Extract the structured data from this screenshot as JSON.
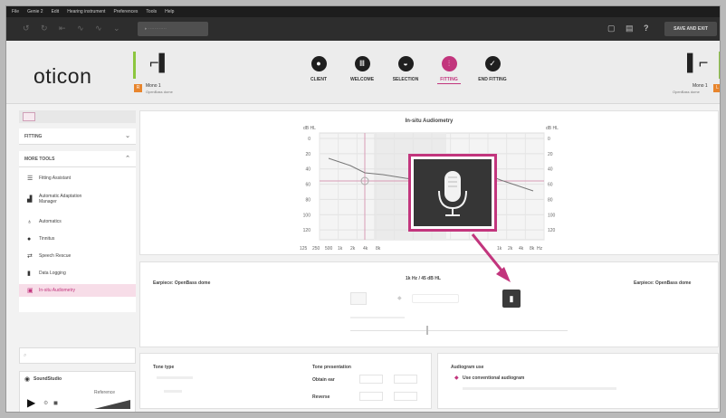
{
  "menubar": [
    "File",
    "Genie 2",
    "Edit",
    "Hearing instrument",
    "Preferences",
    "Tools",
    "Help"
  ],
  "toolbar": {
    "save_exit": "SAVE AND EXIT",
    "help_label": "?"
  },
  "header": {
    "logo": "oticon",
    "left_device": {
      "name": "Mono 1",
      "sub": "OpenBass dome",
      "badge": "R"
    },
    "right_device": {
      "name": "Mono 1",
      "sub": "OpenBass dome",
      "badge": "L"
    },
    "nav": [
      {
        "label": "CLIENT",
        "icon": "person-icon"
      },
      {
        "label": "WELCOME",
        "icon": "welcome-icon"
      },
      {
        "label": "SELECTION",
        "icon": "selection-icon"
      },
      {
        "label": "FITTING",
        "icon": "fitting-icon",
        "active": true
      },
      {
        "label": "END FITTING",
        "icon": "check-icon"
      }
    ]
  },
  "sidebar": {
    "fitting_header": "FITTING",
    "more_tools_header": "MORE TOOLS",
    "items": [
      {
        "label": "Fitting Assistant",
        "icon": "list-icon"
      },
      {
        "label": "Automatic Adaptation",
        "label2": "Manager",
        "icon": "adaptation-icon"
      },
      {
        "label": "Automatics",
        "icon": "automatics-icon"
      },
      {
        "label": "Tinnitus",
        "icon": "tinnitus-icon"
      },
      {
        "label": "Speech Rescue",
        "icon": "speech-rescue-icon"
      },
      {
        "label": "Data Logging",
        "icon": "data-logging-icon"
      },
      {
        "label": "In-situ Audiometry",
        "icon": "in-situ-icon",
        "active": true
      }
    ],
    "sound_studio": "SoundStudio",
    "reference": "Reference"
  },
  "chart": {
    "title": "In-situ Audiometry",
    "left_unit": "dB HL",
    "right_unit": "dB HL",
    "y_ticks": [
      "0",
      "20",
      "40",
      "60",
      "80",
      "100",
      "120"
    ],
    "x_ticks_left": [
      "125",
      "250",
      "500",
      "1k",
      "2k",
      "4k",
      "8k"
    ],
    "x_ticks_right": [
      "1k",
      "2k",
      "4k",
      "8k"
    ],
    "x_unit": "Hz"
  },
  "controls": {
    "left_label": "Earpiece: OpenBass dome",
    "center_label": "1k Hz  /  45 dB HL",
    "right_label": "Earpiece: OpenBass dome"
  },
  "tone": {
    "type_title": "Tone type",
    "presentation_title": "Tone presentation",
    "obtain_ear": "Obtain ear",
    "reverse": "Reverse",
    "audiogram_title": "Audiogram use",
    "audiogram_option": "Use conventional audiogram"
  },
  "colors": {
    "accent": "#c2357d",
    "green": "#8cc63f",
    "orange": "#e8852d",
    "dark": "#2d2d2d"
  }
}
